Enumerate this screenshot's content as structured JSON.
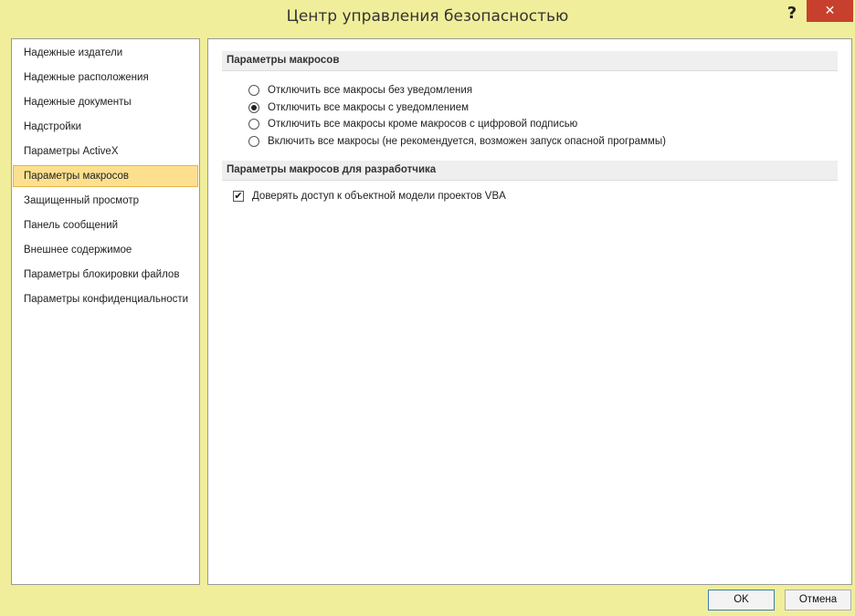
{
  "window": {
    "title": "Центр управления безопасностью",
    "help_label": "?",
    "close_label": "✕"
  },
  "sidebar": {
    "items": [
      {
        "label": "Надежные издатели"
      },
      {
        "label": "Надежные расположения"
      },
      {
        "label": "Надежные документы"
      },
      {
        "label": "Надстройки"
      },
      {
        "label": "Параметры ActiveX"
      },
      {
        "label": "Параметры макросов",
        "selected": true
      },
      {
        "label": "Защищенный просмотр"
      },
      {
        "label": "Панель сообщений"
      },
      {
        "label": "Внешнее содержимое"
      },
      {
        "label": "Параметры блокировки файлов"
      },
      {
        "label": "Параметры конфиденциальности"
      }
    ]
  },
  "macro_settings": {
    "header": "Параметры макросов",
    "options": [
      {
        "label": "Отключить все макросы без уведомления",
        "checked": false
      },
      {
        "label": "Отключить все макросы с уведомлением",
        "checked": true
      },
      {
        "label": "Отключить все макросы кроме макросов с цифровой подписью",
        "checked": false
      },
      {
        "label": "Включить все макросы (не рекомендуется, возможен запуск опасной программы)",
        "checked": false
      }
    ]
  },
  "developer_settings": {
    "header": "Параметры макросов для разработчика",
    "trust_vba": {
      "label": "Доверять доступ к объектной модели проектов VBA",
      "checked": true,
      "mark": "✔"
    }
  },
  "buttons": {
    "ok": "OK",
    "cancel": "Отмена"
  },
  "colors": {
    "title_bar": "#f0ee9a",
    "selected_item": "#fde08f",
    "close_button": "#c7402d"
  }
}
